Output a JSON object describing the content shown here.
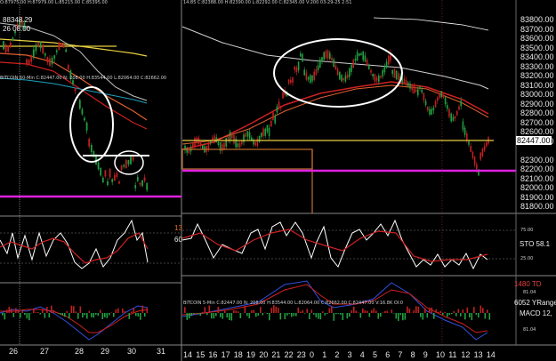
{
  "left_chart": {
    "header": "BITCOIN 60-Min  C:82447.00  N:  208.00  H:83544.00  L:82064.00  C:82662.00",
    "header2": "O:87975.00  H:87979.00  L:85215.00  C:85395.00",
    "price_label": "88348.29",
    "time_label": "26 08:00",
    "osc_label1": "13",
    "osc_label2": "60",
    "x_ticks": [
      "26",
      "27",
      "28",
      "29",
      "30",
      "31"
    ]
  },
  "right_chart": {
    "header": "BITCOIN 5-Min  C:82447.00  N:  208.00  H:83544.00  L:82064.00  C:82662.00  C:82447.00  V:16.8K  OI:0",
    "header2": "14:85  C:82388.00  H:82390.00  L:82292.00  C:82345.00  V:200  03-29-25  2:51",
    "y_ticks": [
      "83800.00",
      "83700.00",
      "83600.00",
      "83500.00",
      "83400.00",
      "83300.00",
      "83200.00",
      "83100.00",
      "83000.00",
      "82900.00",
      "82800.00",
      "82700.00",
      "82600.00",
      "82500.00",
      "82300.00",
      "82200.00",
      "82100.00",
      "82000.00",
      "81900.00",
      "81800.00"
    ],
    "current_price": "82447.00",
    "sto_label": "STO  58.1",
    "sto_levels": [
      "75.00",
      "25.00"
    ],
    "td_label": "1480 TD",
    "yrange_label": "6052 YRange",
    "macd_label": "MACD 12,",
    "macd_small": [
      "81.04",
      "81.04"
    ],
    "x_ticks": [
      "14",
      "15",
      "16",
      "17",
      "18",
      "19",
      "20",
      "21",
      "22",
      "23",
      "0",
      "1",
      "2",
      "3",
      "4",
      "5",
      "6",
      "7",
      "8",
      "9",
      "10",
      "11",
      "12",
      "13",
      "14"
    ],
    "x_tick_last": "14"
  },
  "colors": {
    "background": "#000000",
    "magenta_support": "#e020e0",
    "white_resistance": "#ffffff",
    "yellow_line": "#e8d040",
    "red_ma": "#d02020",
    "orange_box": "#c07030",
    "up_candle": "#20a040",
    "down_candle": "#c02020"
  }
}
